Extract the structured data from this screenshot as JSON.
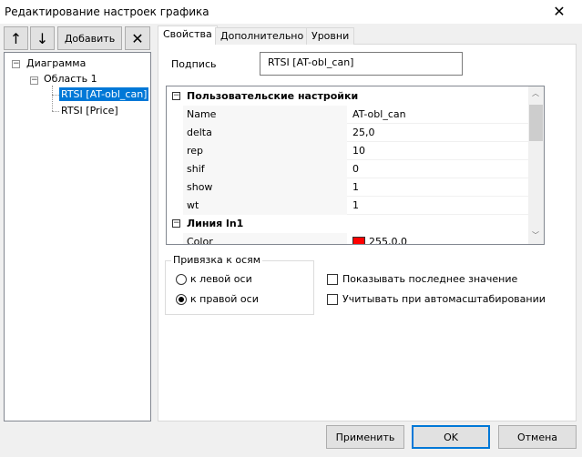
{
  "window": {
    "title": "Редактирование настроек графика",
    "close_icon": "close-icon"
  },
  "toolbar": {
    "up_icon": "↑",
    "down_icon": "↓",
    "add_label": "Добавить",
    "delete_icon": "✕"
  },
  "tree": {
    "root": "Диаграмма",
    "area": "Область 1",
    "items": [
      {
        "label": "RTSI [AT-obl_can]",
        "selected": true
      },
      {
        "label": "RTSI [Price]",
        "selected": false
      }
    ]
  },
  "tabs": [
    {
      "label": "Свойства",
      "active": true
    },
    {
      "label": "Дополнительно",
      "active": false
    },
    {
      "label": "Уровни",
      "active": false
    }
  ],
  "caption": {
    "label": "Подпись",
    "value": "RTSI [AT-obl_can]"
  },
  "grid": {
    "group1": "Пользовательские настройки",
    "rows": [
      {
        "k": "Name",
        "v": "AT-obl_can"
      },
      {
        "k": "delta",
        "v": "25,0"
      },
      {
        "k": "rep",
        "v": "10"
      },
      {
        "k": "shif",
        "v": "0"
      },
      {
        "k": "show",
        "v": "1"
      },
      {
        "k": "wt",
        "v": "1"
      }
    ],
    "group2": "Линия ln1",
    "color_row": {
      "k": "Color",
      "v": "255,0,0",
      "swatch": "#ff0000"
    }
  },
  "axis": {
    "title": "Привязка к осям",
    "left": "к левой оси",
    "right": "к правой оси",
    "selected": "right"
  },
  "checks": {
    "show_last": "Показывать последнее значение",
    "autoscale": "Учитывать при автомасштабировании"
  },
  "buttons": {
    "apply": "Применить",
    "ok": "OK",
    "cancel": "Отмена"
  }
}
